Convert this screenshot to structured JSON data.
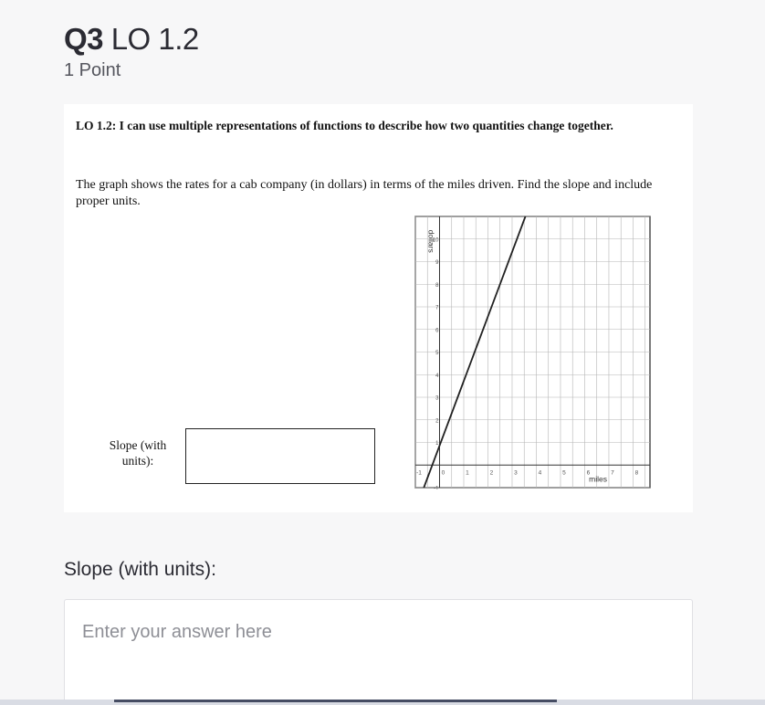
{
  "question": {
    "number": "Q3",
    "title": "LO 1.2",
    "points": "1 Point"
  },
  "card": {
    "lo_statement": "LO 1.2:  I can use multiple representations of functions to describe how two quantities change together.",
    "prompt": "The graph shows the rates for a cab company (in dollars) in terms of the miles driven.  Find the slope and include proper units.",
    "slope_label": "Slope (with units):"
  },
  "chart_data": {
    "type": "line",
    "xlabel": "miles",
    "ylabel": "dollars",
    "xlim": [
      -1,
      8.7
    ],
    "ylim": [
      -1,
      11
    ],
    "x_ticks": [
      "-1",
      "0",
      "1",
      "2",
      "3",
      "4",
      "5",
      "6",
      "7",
      "8"
    ],
    "y_ticks": [
      "-1",
      "1",
      "2",
      "3",
      "4",
      "5",
      "6",
      "7",
      "8",
      "9",
      "10"
    ],
    "grid": true,
    "series": [
      {
        "x": [
          -0.65,
          3.55
        ],
        "y": [
          -1,
          11
        ]
      }
    ],
    "line_slope": 3,
    "line_intercept": 1.9
  },
  "answer": {
    "label": "Slope (with units):",
    "placeholder": "Enter your answer here"
  }
}
